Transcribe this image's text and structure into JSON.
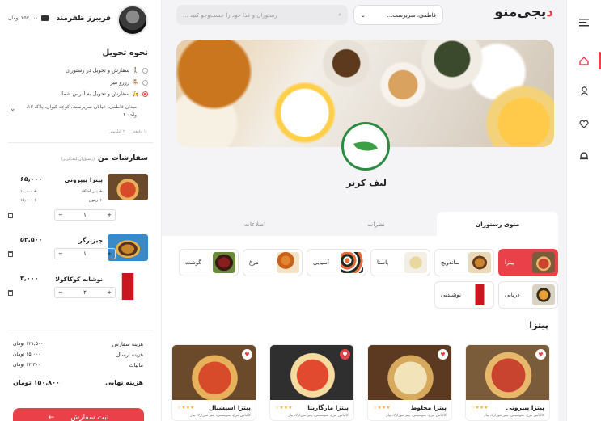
{
  "brand": {
    "logo_main": "یجی‌منو",
    "logo_accent": "د",
    "accent_color": "#e9404a"
  },
  "rail": {
    "icons": [
      "menu-icon",
      "home-icon",
      "user-icon",
      "heart-icon",
      "bell-icon"
    ]
  },
  "header": {
    "location": "فاطمی، سریرست...",
    "search_placeholder": "رستوران و غذا خود را جست‌وجو کنید ..."
  },
  "user": {
    "name": "فریبرز ظفرمند",
    "wallet": "۲۵۷,۰۰۰ تومان"
  },
  "delivery": {
    "title": "نحوه تحویل",
    "options": [
      {
        "label": "سفارش و تحویل در رستوران",
        "selected": false
      },
      {
        "label": "رزرو میز",
        "selected": false
      },
      {
        "label": "سفارش و تحویل به آدرس شما",
        "selected": true
      }
    ],
    "address": "میدان فاطمی، خیابان سریرست، کوچه کیوان، پلاک ۱۳، واحد ۴",
    "time": "۱۰ دقیقه",
    "distance": "۲ کیلومتر"
  },
  "orders": {
    "title": "سفارشات من",
    "subtitle": "(رستوران لیف‌کرنر)",
    "items": [
      {
        "name": "پیتزا پیپرونی",
        "price": "۶۵,۰۰۰",
        "addons": [
          {
            "label": "+ پنیر اضافه",
            "price": "+ ۱۰,۰۰۰"
          },
          {
            "label": "+ زیتون",
            "price": "+ ۱۵,۰۰۰"
          }
        ],
        "qty": "۱"
      },
      {
        "name": "چیزبرگر",
        "price": "۵۳,۵۰۰",
        "addons": [],
        "qty": "۱"
      },
      {
        "name": "نوشابه کوکاکولا",
        "price": "۳,۰۰۰",
        "addons": [],
        "qty": "۲"
      }
    ]
  },
  "summary": {
    "order_cost_label": "هزینه سفارش",
    "order_cost": "۱۲۱,۵۰۰ تومان",
    "shipping_label": "هزینه ارسال",
    "shipping": "۱۵,۰۰۰ تومان",
    "tax_label": "مالیات",
    "tax": "۱۲,۳۰۰ تومان",
    "total_label": "هزینه نهایی",
    "total": "۱۵۰,۸۰۰ تومان",
    "submit_label": "ثبت سفارش"
  },
  "restaurant": {
    "name": "لیف کرنر"
  },
  "tabs": [
    "منوی رستوران",
    "نظرات",
    "اطلاعات"
  ],
  "categories": [
    {
      "label": "پیتزا",
      "active": true
    },
    {
      "label": "ساندویچ",
      "active": false
    },
    {
      "label": "پاستا",
      "active": false
    },
    {
      "label": "آسیایی",
      "active": false
    },
    {
      "label": "مرغ",
      "active": false
    },
    {
      "label": "گوشت",
      "active": false
    },
    {
      "label": "دریایی",
      "active": false
    },
    {
      "label": "نوشیدنی",
      "active": false
    }
  ],
  "section_title": "پیتزا",
  "foods": [
    {
      "name": "پیتزا پیپرونی",
      "desc": "کالباس مرغ، سوسیس، پنیر موزارلا، پیاز",
      "stars": "★★★☆",
      "liked": false
    },
    {
      "name": "پیتزا مخلوط",
      "desc": "کالباس مرغ، سوسیس، پنیر موزارلا، پیاز",
      "stars": "★★★☆",
      "liked": false
    },
    {
      "name": "پیتزا مارگاریتا",
      "desc": "کالباس مرغ، سوسیس، پنیر موزارلا، پیاز",
      "stars": "★★★☆",
      "liked": true
    },
    {
      "name": "پیتزا اسپشیال",
      "desc": "کالباس مرغ، سوسیس، پنیر موزارلا، پیاز",
      "stars": "★★★☆",
      "liked": false
    }
  ]
}
